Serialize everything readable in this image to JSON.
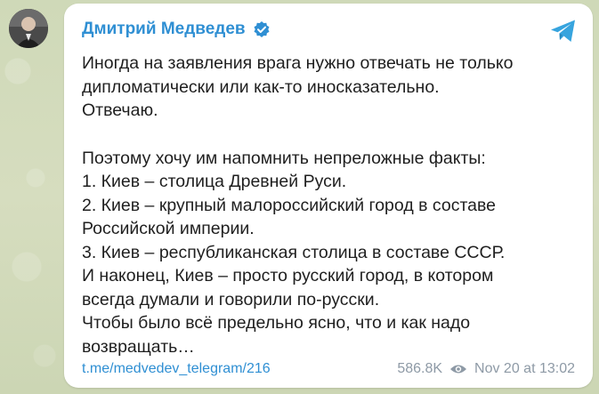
{
  "channel": {
    "author": "Дмитрий Медведев",
    "verified_icon": "verified-badge-icon",
    "app_icon": "telegram-icon",
    "accent_color": "#2f8fd3"
  },
  "message": {
    "paragraph1": [
      "Иногда на заявления врага нужно отвечать не только",
      "дипломатически или как-то иносказательно.",
      "Отвечаю."
    ],
    "paragraph2": [
      "Поэтому хочу им напомнить непреложные факты:",
      "1. Киев – столица Древней Руси.",
      "2. Киев – крупный малороссийский город в составе",
      "Российской империи.",
      "3. Киев – республиканская столица в составе СССР.",
      "И наконец, Киев – просто русский город, в котором",
      "всегда думали и говорили по-русски.",
      "Чтобы было всё предельно ясно, что и как надо",
      "возвращать…"
    ]
  },
  "footer": {
    "link": "t.me/medvedev_telegram/216",
    "views": "586.8K",
    "views_icon": "eye-icon",
    "timestamp": "Nov 20 at 13:02"
  }
}
